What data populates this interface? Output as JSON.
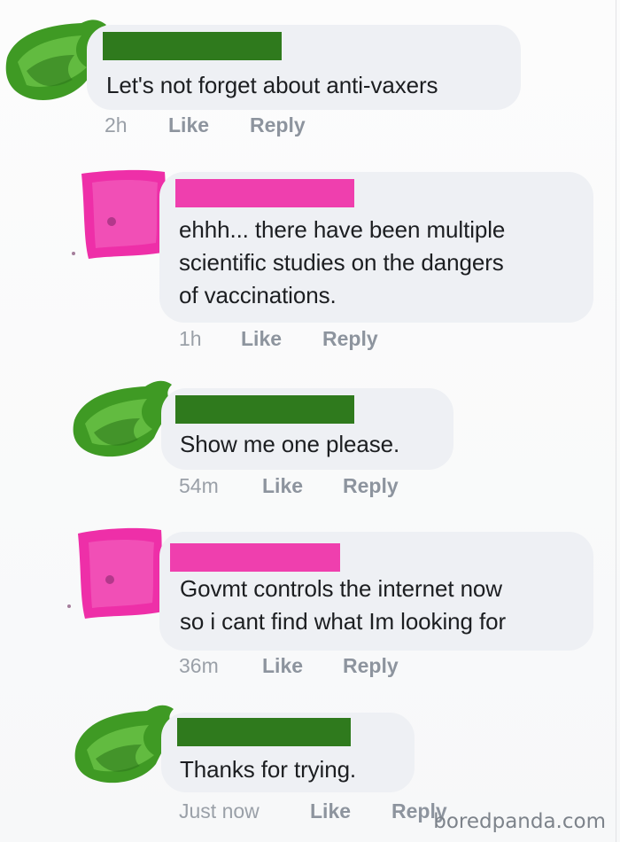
{
  "comments": [
    {
      "text_lines": [
        "Let's not forget about anti-vaxers"
      ],
      "time": "2h",
      "like": "Like",
      "reply": "Reply"
    },
    {
      "text_lines": [
        "ehhh... there have been multiple",
        "scientific studies on the dangers",
        "of vaccinations."
      ],
      "time": "1h",
      "like": "Like",
      "reply": "Reply"
    },
    {
      "text_lines": [
        "Show me one please."
      ],
      "time": "54m",
      "like": "Like",
      "reply": "Reply"
    },
    {
      "text_lines": [
        "Govmt controls the internet now",
        "so i cant find what Im looking for"
      ],
      "time": "36m",
      "like": "Like",
      "reply": "Reply"
    },
    {
      "text_lines": [
        "Thanks for trying."
      ],
      "time": "Just now",
      "like": "Like",
      "reply": "Reply"
    }
  ],
  "colors": {
    "redaction_green": "#2f7a1d",
    "redaction_pink": "#ef3fae",
    "bubble": "#eef0f4",
    "meta_text": "#8d949e"
  },
  "watermark": "boredpanda.com"
}
